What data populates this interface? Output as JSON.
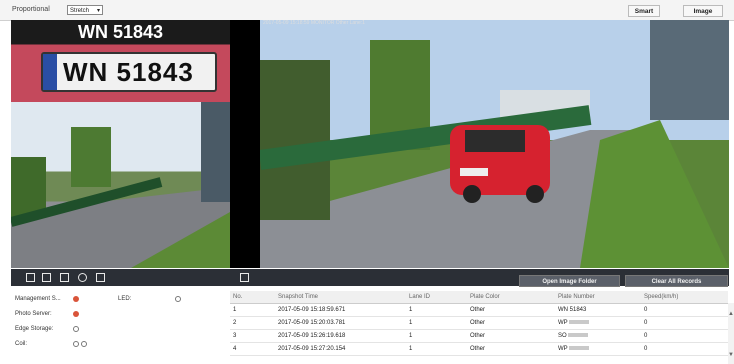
{
  "topbar": {
    "proportional_label": "Proportional",
    "stretch_value": "Stretch",
    "smart_label": "Smart",
    "image_label": "Image"
  },
  "video": {
    "plate_text": "WN 51843",
    "plate_image_text": "WN 51843",
    "overlay_text": "2017-05-09 15:18:59 MONITOR Other Lane:1"
  },
  "toolbar": {
    "open_folder_label": "Open Image Folder",
    "clear_records_label": "Clear All Records"
  },
  "status": {
    "items": [
      {
        "label": "Management S...",
        "state": "on"
      },
      {
        "label": "Photo Server:",
        "state": "on"
      },
      {
        "label": "Edge Storage:",
        "state": "off"
      },
      {
        "label": "Coil:",
        "state": "off"
      }
    ],
    "led_label": "LED:"
  },
  "records": {
    "columns": [
      "No.",
      "Snapshot Time",
      "Lane ID",
      "Plate Color",
      "Plate Number",
      "Speed(km/h)"
    ],
    "rows": [
      {
        "no": "1",
        "time": "2017-05-09 15:18:59.671",
        "lane": "1",
        "color": "Other",
        "plate": "WN 51843",
        "speed": "0"
      },
      {
        "no": "2",
        "time": "2017-05-09 15:20:03.781",
        "lane": "1",
        "color": "Other",
        "plate": "WP",
        "speed": "0"
      },
      {
        "no": "3",
        "time": "2017-05-09 15:26:19.618",
        "lane": "1",
        "color": "Other",
        "plate": "SO",
        "speed": "0"
      },
      {
        "no": "4",
        "time": "2017-05-09 15:27:20.154",
        "lane": "1",
        "color": "Other",
        "plate": "WP",
        "speed": "0"
      }
    ]
  }
}
